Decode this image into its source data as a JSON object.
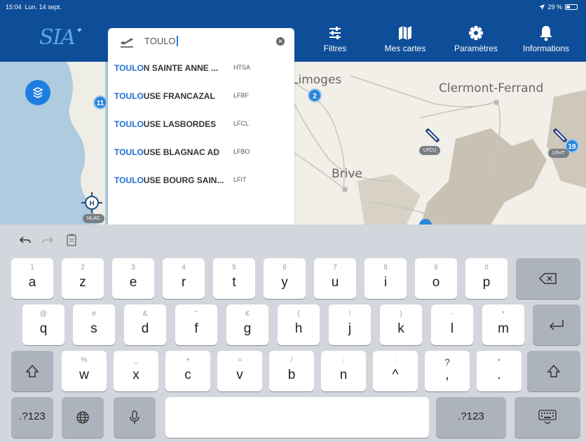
{
  "status": {
    "time": "15:04",
    "date": "Lun. 14 sept.",
    "battery": "29 %"
  },
  "app": {
    "logo": "SIA"
  },
  "search": {
    "value": "TOULO"
  },
  "nav": [
    {
      "label": "Filtres",
      "icon": "sliders-icon"
    },
    {
      "label": "Mes cartes",
      "icon": "map-icon"
    },
    {
      "label": "Paramètres",
      "icon": "gear-icon"
    },
    {
      "label": "Informations",
      "icon": "bell-icon"
    }
  ],
  "results": [
    {
      "match": "TOULO",
      "rest": "N SAINTE ANNE ...",
      "code": "HTSA"
    },
    {
      "match": "TOULO",
      "rest": "USE FRANCAZAL",
      "code": "LFBF"
    },
    {
      "match": "TOULO",
      "rest": "USE LASBORDES",
      "code": "LFCL"
    },
    {
      "match": "TOULO",
      "rest": "USE BLAGNAC AD",
      "code": "LFBO"
    },
    {
      "match": "TOULO",
      "rest": "USE BOURG SAIN...",
      "code": "LFIT"
    }
  ],
  "map": {
    "cities": [
      "Limoges",
      "Clermont-Ferrand",
      "Brive"
    ],
    "clusters": [
      "11",
      "2",
      "19"
    ],
    "badges": [
      "HLAC",
      "LFCU",
      "LFHT"
    ]
  },
  "keyboard": {
    "row1": [
      {
        "hint": "1",
        "key": "a"
      },
      {
        "hint": "2",
        "key": "z"
      },
      {
        "hint": "3",
        "key": "e"
      },
      {
        "hint": "4",
        "key": "r"
      },
      {
        "hint": "5",
        "key": "t"
      },
      {
        "hint": "6",
        "key": "y"
      },
      {
        "hint": "7",
        "key": "u"
      },
      {
        "hint": "8",
        "key": "i"
      },
      {
        "hint": "9",
        "key": "o"
      },
      {
        "hint": "0",
        "key": "p"
      }
    ],
    "row2": [
      {
        "hint": "@",
        "key": "q"
      },
      {
        "hint": "#",
        "key": "s"
      },
      {
        "hint": "&",
        "key": "d"
      },
      {
        "hint": "\"",
        "key": "f"
      },
      {
        "hint": "€",
        "key": "g"
      },
      {
        "hint": "(",
        "key": "h"
      },
      {
        "hint": "!",
        "key": "j"
      },
      {
        "hint": ")",
        "key": "k"
      },
      {
        "hint": "-",
        "key": "l"
      },
      {
        "hint": "*",
        "key": "m"
      }
    ],
    "row3": [
      {
        "hint": "%",
        "key": "w"
      },
      {
        "hint": "_",
        "key": "x"
      },
      {
        "hint": "+",
        "key": "c"
      },
      {
        "hint": "=",
        "key": "v"
      },
      {
        "hint": "/",
        "key": "b"
      },
      {
        "hint": ";",
        "key": "n"
      },
      {
        "hint": ":",
        "key": "^"
      },
      {
        "hint": "?",
        "key": ","
      },
      {
        "hint": "'",
        "key": "."
      }
    ],
    "numbers_label": ".?123"
  },
  "colors": {
    "brand": "#0e4e98",
    "accent": "#1d6fd3",
    "cluster": "#2a86d8"
  }
}
